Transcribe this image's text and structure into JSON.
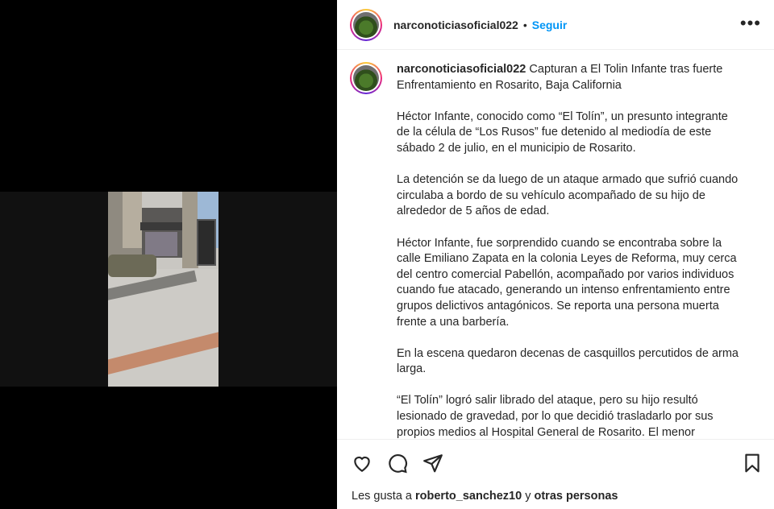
{
  "post": {
    "author": "narconoticiasoficial022",
    "separator": "•",
    "follow_label": "Seguir",
    "more_label": "•••"
  },
  "caption": {
    "username": "narconoticiasoficial022",
    "headline": "Capturan a El Tolin Infante tras fuerte Enfrentamiento en Rosarito, Baja California",
    "paragraphs": [
      "Héctor Infante, conocido como “El Tolín”, un presunto integrante de la célula de “Los Rusos” fue detenido al mediodía de este sábado 2 de julio, en el municipio de Rosarito.",
      "La detención se da luego de un ataque armado que sufrió cuando circulaba a bordo de su vehículo acompañado de su hijo de alrededor de 5 años de edad.",
      "Héctor Infante, fue sorprendido cuando se encontraba sobre la calle Emiliano Zapata en la colonia Leyes de Reforma, muy cerca del centro comercial Pabellón, acompañado por varios individuos cuando fue atacado, generando un intenso enfrentamiento entre grupos delictivos antagónicos. Se reporta una persona muerta frente a una barbería.",
      "En la escena quedaron decenas de casquillos percutidos de arma larga.",
      "“El Tolín” logró salir librado del ataque, pero su hijo resultó lesionado de gravedad, por lo que decidió trasladarlo por sus propios medios al Hospital General de Rosarito. El menor"
    ]
  },
  "likes": {
    "prefix": "Les gusta a",
    "user": "roberto_sanchez10",
    "conjunction": "y",
    "others": "otras personas"
  },
  "icons": {
    "like": "heart-icon",
    "comment": "comment-icon",
    "share": "send-icon",
    "save": "bookmark-icon",
    "more": "more-icon"
  },
  "colors": {
    "follow": "#0095f6",
    "text": "#262626",
    "border": "#efefef"
  }
}
